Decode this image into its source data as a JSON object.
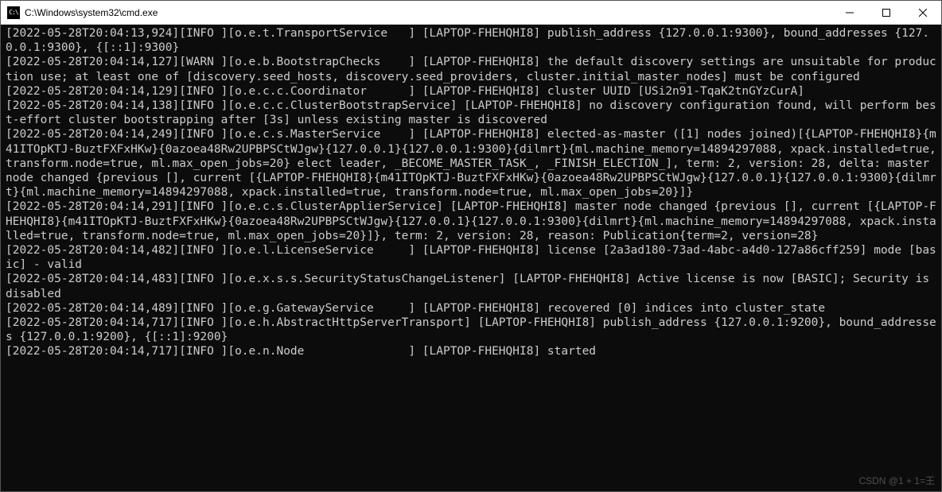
{
  "window": {
    "title": "C:\\Windows\\system32\\cmd.exe",
    "icon_label": "C:\\"
  },
  "controls": {
    "minimize": "minimize",
    "maximize": "maximize",
    "close": "close"
  },
  "watermark": "CSDN @1 + 1=王",
  "log_lines": [
    "[2022-05-28T20:04:13,924][INFO ][o.e.t.TransportService   ] [LAPTOP-FHEHQHI8] publish_address {127.0.0.1:9300}, bound_addresses {127.0.0.1:9300}, {[::1]:9300}",
    "[2022-05-28T20:04:14,127][WARN ][o.e.b.BootstrapChecks    ] [LAPTOP-FHEHQHI8] the default discovery settings are unsuitable for production use; at least one of [discovery.seed_hosts, discovery.seed_providers, cluster.initial_master_nodes] must be configured",
    "[2022-05-28T20:04:14,129][INFO ][o.e.c.c.Coordinator      ] [LAPTOP-FHEHQHI8] cluster UUID [USi2n91-TqaK2tnGYzCurA]",
    "[2022-05-28T20:04:14,138][INFO ][o.e.c.c.ClusterBootstrapService] [LAPTOP-FHEHQHI8] no discovery configuration found, will perform best-effort cluster bootstrapping after [3s] unless existing master is discovered",
    "[2022-05-28T20:04:14,249][INFO ][o.e.c.s.MasterService    ] [LAPTOP-FHEHQHI8] elected-as-master ([1] nodes joined)[{LAPTOP-FHEHQHI8}{m41ITOpKTJ-BuztFXFxHKw}{0azoea48Rw2UPBPSCtWJgw}{127.0.0.1}{127.0.0.1:9300}{dilmrt}{ml.machine_memory=14894297088, xpack.installed=true, transform.node=true, ml.max_open_jobs=20} elect leader, _BECOME_MASTER_TASK_, _FINISH_ELECTION_], term: 2, version: 28, delta: master node changed {previous [], current [{LAPTOP-FHEHQHI8}{m41ITOpKTJ-BuztFXFxHKw}{0azoea48Rw2UPBPSCtWJgw}{127.0.0.1}{127.0.0.1:9300}{dilmrt}{ml.machine_memory=14894297088, xpack.installed=true, transform.node=true, ml.max_open_jobs=20}]}",
    "[2022-05-28T20:04:14,291][INFO ][o.e.c.s.ClusterApplierService] [LAPTOP-FHEHQHI8] master node changed {previous [], current [{LAPTOP-FHEHQHI8}{m41ITOpKTJ-BuztFXFxHKw}{0azoea48Rw2UPBPSCtWJgw}{127.0.0.1}{127.0.0.1:9300}{dilmrt}{ml.machine_memory=14894297088, xpack.installed=true, transform.node=true, ml.max_open_jobs=20}]}, term: 2, version: 28, reason: Publication{term=2, version=28}",
    "[2022-05-28T20:04:14,482][INFO ][o.e.l.LicenseService     ] [LAPTOP-FHEHQHI8] license [2a3ad180-73ad-4abc-a4d0-127a86cff259] mode [basic] - valid",
    "[2022-05-28T20:04:14,483][INFO ][o.e.x.s.s.SecurityStatusChangeListener] [LAPTOP-FHEHQHI8] Active license is now [BASIC]; Security is disabled",
    "[2022-05-28T20:04:14,489][INFO ][o.e.g.GatewayService     ] [LAPTOP-FHEHQHI8] recovered [0] indices into cluster_state",
    "[2022-05-28T20:04:14,717][INFO ][o.e.h.AbstractHttpServerTransport] [LAPTOP-FHEHQHI8] publish_address {127.0.0.1:9200}, bound_addresses {127.0.0.1:9200}, {[::1]:9200}",
    "[2022-05-28T20:04:14,717][INFO ][o.e.n.Node               ] [LAPTOP-FHEHQHI8] started"
  ]
}
